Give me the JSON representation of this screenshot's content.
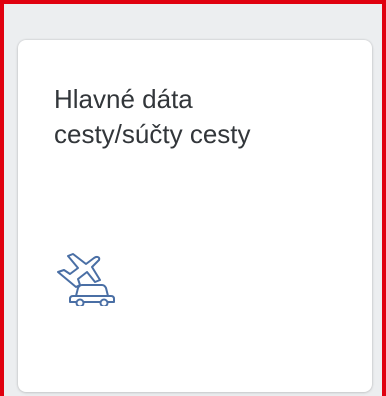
{
  "tile": {
    "title": "Hlavné dáta\ncesty/súčty cesty",
    "icon": "travel-plane-car-icon",
    "icon_color": "#4a6fa5"
  },
  "frame": {
    "highlight_color": "#e0000f",
    "background_color": "#eceef0"
  }
}
